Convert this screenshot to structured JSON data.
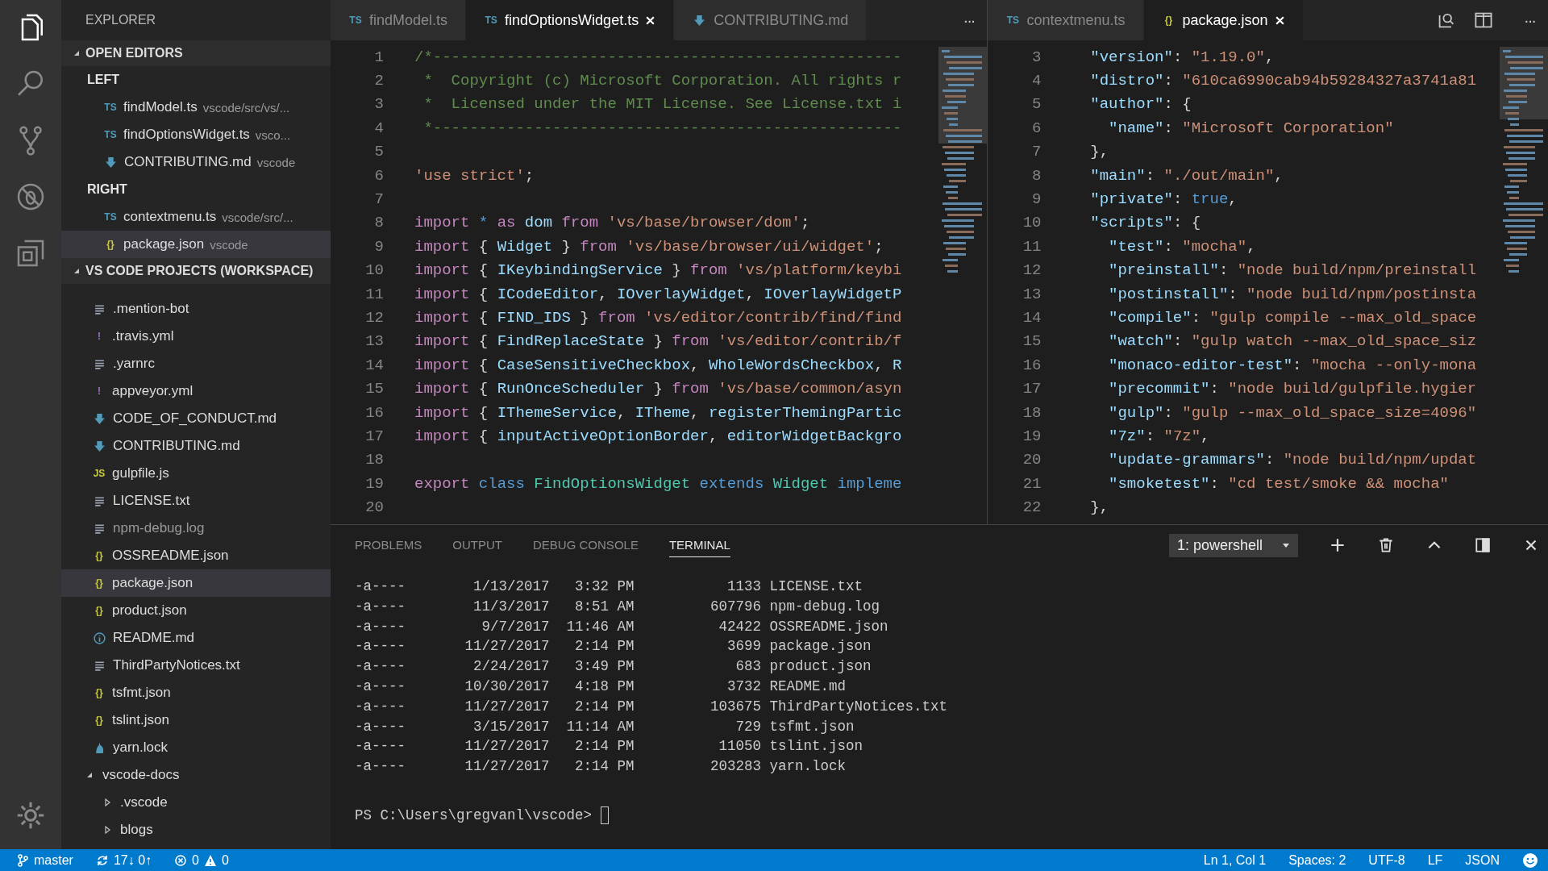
{
  "activity_bar": {
    "items": [
      {
        "kind": "files",
        "selected": true
      },
      {
        "kind": "search",
        "selected": false
      },
      {
        "kind": "scm",
        "selected": false
      },
      {
        "kind": "debug",
        "selected": false
      },
      {
        "kind": "extensions",
        "selected": false
      }
    ]
  },
  "sidebar": {
    "title": "EXPLORER",
    "open_editors": {
      "title": "OPEN EDITORS",
      "expanded": true,
      "groups": [
        {
          "label": "LEFT",
          "items": [
            {
              "icon_text": "TS",
              "kind": "ts",
              "name": "findModel.ts",
              "path": "vscode/src/vs/...",
              "selected": false
            },
            {
              "icon_text": "TS",
              "kind": "ts",
              "name": "findOptionsWidget.ts",
              "path": "vsco...",
              "selected": false
            },
            {
              "kind": "md",
              "name": "CONTRIBUTING.md",
              "path": "vscode",
              "selected": false
            }
          ]
        },
        {
          "label": "RIGHT",
          "items": [
            {
              "icon_text": "TS",
              "kind": "ts",
              "name": "contextmenu.ts",
              "path": "vscode/src/...",
              "selected": false
            },
            {
              "icon_text": "{}",
              "kind": "json",
              "name": "package.json",
              "path": "vscode",
              "selected": true
            }
          ]
        }
      ]
    },
    "workspace": {
      "title": "VS CODE PROJECTS (WORKSPACE)",
      "expanded": true,
      "items": [
        {
          "kind": "text",
          "name": ".mention-bot",
          "selected": false
        },
        {
          "icon_text": "!",
          "kind": "yaml",
          "name": ".travis.yml",
          "selected": false
        },
        {
          "kind": "text",
          "name": ".yarnrc",
          "selected": false
        },
        {
          "icon_text": "!",
          "kind": "yaml",
          "name": "appveyor.yml",
          "selected": false
        },
        {
          "kind": "md",
          "name": "CODE_OF_CONDUCT.md",
          "selected": false
        },
        {
          "kind": "md",
          "name": "CONTRIBUTING.md",
          "selected": false
        },
        {
          "icon_text": "JS",
          "kind": "js",
          "name": "gulpfile.js",
          "selected": false
        },
        {
          "kind": "text",
          "name": "LICENSE.txt",
          "selected": false
        },
        {
          "kind": "log",
          "name": "npm-debug.log",
          "selected": false
        },
        {
          "icon_text": "{}",
          "kind": "json",
          "name": "OSSREADME.json",
          "selected": false
        },
        {
          "icon_text": "{}",
          "kind": "json",
          "name": "package.json",
          "selected": true
        },
        {
          "icon_text": "{}",
          "kind": "json",
          "name": "product.json",
          "selected": false
        },
        {
          "kind": "info",
          "name": "README.md",
          "selected": false
        },
        {
          "kind": "text",
          "name": "ThirdPartyNotices.txt",
          "selected": false
        },
        {
          "icon_text": "{}",
          "kind": "json",
          "name": "tsfmt.json",
          "selected": false
        },
        {
          "icon_text": "{}",
          "kind": "json",
          "name": "tslint.json",
          "selected": false
        },
        {
          "kind": "yarn",
          "name": "yarn.lock",
          "selected": false
        },
        {
          "kind": "folder",
          "name": "vscode-docs",
          "selected": false,
          "expanded": true,
          "children": [
            {
              "kind": "folder",
              "name": ".vscode",
              "selected": false,
              "expanded": false
            },
            {
              "kind": "folder",
              "name": "blogs",
              "selected": false,
              "expanded": false
            }
          ]
        }
      ]
    }
  },
  "editor_groups": [
    {
      "tabs": [
        {
          "icon_text": "TS",
          "kind": "ts",
          "label": "findModel.ts",
          "selected": false
        },
        {
          "icon_text": "TS",
          "kind": "ts",
          "label": "findOptionsWidget.ts",
          "selected": true
        },
        {
          "kind": "md",
          "label": "CONTRIBUTING.md",
          "selected": false
        }
      ],
      "more_button": "···",
      "lines": [
        {
          "number": "1",
          "tokens": [
            {
              "kind": "comment",
              "text": "/*---------------------------------------------------"
            }
          ]
        },
        {
          "number": "2",
          "tokens": [
            {
              "kind": "comment",
              "text": " *  Copyright (c) Microsoft Corporation. All rights r"
            }
          ]
        },
        {
          "number": "3",
          "tokens": [
            {
              "kind": "comment",
              "text": " *  Licensed under the MIT License. See License.txt i"
            }
          ]
        },
        {
          "number": "4",
          "tokens": [
            {
              "kind": "comment",
              "text": " *---------------------------------------------------"
            }
          ]
        },
        {
          "number": "5"
        },
        {
          "number": "6",
          "tokens": [
            {
              "kind": "string",
              "text": "'use strict'"
            },
            {
              "kind": "plain",
              "text": ";"
            }
          ]
        },
        {
          "number": "7"
        },
        {
          "number": "8",
          "tokens": [
            {
              "kind": "keyword",
              "text": "import "
            },
            {
              "kind": "storage",
              "text": "* "
            },
            {
              "kind": "keyword",
              "text": "as "
            },
            {
              "kind": "identifier",
              "text": "dom "
            },
            {
              "kind": "keyword",
              "text": "from "
            },
            {
              "kind": "string",
              "text": "'vs/base/browser/dom'"
            },
            {
              "kind": "plain",
              "text": ";"
            }
          ]
        },
        {
          "number": "9",
          "tokens": [
            {
              "kind": "keyword",
              "text": "import "
            },
            {
              "kind": "plain",
              "text": "{ "
            },
            {
              "kind": "identifier",
              "text": "Widget "
            },
            {
              "kind": "plain",
              "text": "} "
            },
            {
              "kind": "keyword",
              "text": "from "
            },
            {
              "kind": "string",
              "text": "'vs/base/browser/ui/widget'"
            },
            {
              "kind": "plain",
              "text": ";"
            }
          ]
        },
        {
          "number": "10",
          "tokens": [
            {
              "kind": "keyword",
              "text": "import "
            },
            {
              "kind": "plain",
              "text": "{ "
            },
            {
              "kind": "identifier",
              "text": "IKeybindingService "
            },
            {
              "kind": "plain",
              "text": "} "
            },
            {
              "kind": "keyword",
              "text": "from "
            },
            {
              "kind": "string",
              "text": "'vs/platform/keybi"
            }
          ]
        },
        {
          "number": "11",
          "tokens": [
            {
              "kind": "keyword",
              "text": "import "
            },
            {
              "kind": "plain",
              "text": "{ "
            },
            {
              "kind": "identifier",
              "text": "ICodeEditor"
            },
            {
              "kind": "plain",
              "text": ", "
            },
            {
              "kind": "identifier",
              "text": "IOverlayWidget"
            },
            {
              "kind": "plain",
              "text": ", "
            },
            {
              "kind": "identifier",
              "text": "IOverlayWidgetP"
            }
          ]
        },
        {
          "number": "12",
          "tokens": [
            {
              "kind": "keyword",
              "text": "import "
            },
            {
              "kind": "plain",
              "text": "{ "
            },
            {
              "kind": "identifier",
              "text": "FIND_IDS "
            },
            {
              "kind": "plain",
              "text": "} "
            },
            {
              "kind": "keyword",
              "text": "from "
            },
            {
              "kind": "string",
              "text": "'vs/editor/contrib/find/find"
            }
          ]
        },
        {
          "number": "13",
          "tokens": [
            {
              "kind": "keyword",
              "text": "import "
            },
            {
              "kind": "plain",
              "text": "{ "
            },
            {
              "kind": "identifier",
              "text": "FindReplaceState "
            },
            {
              "kind": "plain",
              "text": "} "
            },
            {
              "kind": "keyword",
              "text": "from "
            },
            {
              "kind": "string",
              "text": "'vs/editor/contrib/f"
            }
          ]
        },
        {
          "number": "14",
          "tokens": [
            {
              "kind": "keyword",
              "text": "import "
            },
            {
              "kind": "plain",
              "text": "{ "
            },
            {
              "kind": "identifier",
              "text": "CaseSensitiveCheckbox"
            },
            {
              "kind": "plain",
              "text": ", "
            },
            {
              "kind": "identifier",
              "text": "WholeWordsCheckbox"
            },
            {
              "kind": "plain",
              "text": ", "
            },
            {
              "kind": "identifier",
              "text": "R"
            }
          ]
        },
        {
          "number": "15",
          "tokens": [
            {
              "kind": "keyword",
              "text": "import "
            },
            {
              "kind": "plain",
              "text": "{ "
            },
            {
              "kind": "identifier",
              "text": "RunOnceScheduler "
            },
            {
              "kind": "plain",
              "text": "} "
            },
            {
              "kind": "keyword",
              "text": "from "
            },
            {
              "kind": "string",
              "text": "'vs/base/common/asyn"
            }
          ]
        },
        {
          "number": "16",
          "tokens": [
            {
              "kind": "keyword",
              "text": "import "
            },
            {
              "kind": "plain",
              "text": "{ "
            },
            {
              "kind": "identifier",
              "text": "IThemeService"
            },
            {
              "kind": "plain",
              "text": ", "
            },
            {
              "kind": "identifier",
              "text": "ITheme"
            },
            {
              "kind": "plain",
              "text": ", "
            },
            {
              "kind": "identifier",
              "text": "registerThemingPartic"
            }
          ]
        },
        {
          "number": "17",
          "tokens": [
            {
              "kind": "keyword",
              "text": "import "
            },
            {
              "kind": "plain",
              "text": "{ "
            },
            {
              "kind": "identifier",
              "text": "inputActiveOptionBorder"
            },
            {
              "kind": "plain",
              "text": ", "
            },
            {
              "kind": "identifier",
              "text": "editorWidgetBackgro"
            }
          ]
        },
        {
          "number": "18"
        },
        {
          "number": "19",
          "tokens": [
            {
              "kind": "keyword",
              "text": "export "
            },
            {
              "kind": "storage",
              "text": "class "
            },
            {
              "kind": "type",
              "text": "FindOptionsWidget "
            },
            {
              "kind": "storage",
              "text": "extends "
            },
            {
              "kind": "type",
              "text": "Widget "
            },
            {
              "kind": "storage",
              "text": "impleme"
            }
          ]
        },
        {
          "number": "20"
        }
      ]
    },
    {
      "tabs": [
        {
          "icon_text": "TS",
          "kind": "ts",
          "label": "contextmenu.ts",
          "selected": false
        },
        {
          "icon_text": "{}",
          "kind": "json",
          "label": "package.json",
          "selected": true
        }
      ],
      "more_button": "···",
      "lines": [
        {
          "number": "3",
          "tokens": [
            {
              "kind": "identifier",
              "text": "  \"version\""
            },
            {
              "kind": "plain",
              "text": ": "
            },
            {
              "kind": "string",
              "text": "\"1.19.0\""
            },
            {
              "kind": "plain",
              "text": ","
            }
          ]
        },
        {
          "number": "4",
          "tokens": [
            {
              "kind": "identifier",
              "text": "  \"distro\""
            },
            {
              "kind": "plain",
              "text": ": "
            },
            {
              "kind": "string",
              "text": "\"610ca6990cab94b59284327a3741a81"
            }
          ]
        },
        {
          "number": "5",
          "tokens": [
            {
              "kind": "identifier",
              "text": "  \"author\""
            },
            {
              "kind": "plain",
              "text": ": {"
            }
          ]
        },
        {
          "number": "6",
          "tokens": [
            {
              "kind": "identifier",
              "text": "    \"name\""
            },
            {
              "kind": "plain",
              "text": ": "
            },
            {
              "kind": "string",
              "text": "\"Microsoft Corporation\""
            }
          ]
        },
        {
          "number": "7",
          "tokens": [
            {
              "kind": "plain",
              "text": "  },"
            }
          ]
        },
        {
          "number": "8",
          "tokens": [
            {
              "kind": "identifier",
              "text": "  \"main\""
            },
            {
              "kind": "plain",
              "text": ": "
            },
            {
              "kind": "string",
              "text": "\"./out/main\""
            },
            {
              "kind": "plain",
              "text": ","
            }
          ]
        },
        {
          "number": "9",
          "tokens": [
            {
              "kind": "identifier",
              "text": "  \"private\""
            },
            {
              "kind": "plain",
              "text": ": "
            },
            {
              "kind": "storage",
              "text": "true"
            },
            {
              "kind": "plain",
              "text": ","
            }
          ]
        },
        {
          "number": "10",
          "tokens": [
            {
              "kind": "identifier",
              "text": "  \"scripts\""
            },
            {
              "kind": "plain",
              "text": ": {"
            }
          ]
        },
        {
          "number": "11",
          "tokens": [
            {
              "kind": "identifier",
              "text": "    \"test\""
            },
            {
              "kind": "plain",
              "text": ": "
            },
            {
              "kind": "string",
              "text": "\"mocha\""
            },
            {
              "kind": "plain",
              "text": ","
            }
          ]
        },
        {
          "number": "12",
          "tokens": [
            {
              "kind": "identifier",
              "text": "    \"preinstall\""
            },
            {
              "kind": "plain",
              "text": ": "
            },
            {
              "kind": "string",
              "text": "\"node build/npm/preinstall"
            }
          ]
        },
        {
          "number": "13",
          "tokens": [
            {
              "kind": "identifier",
              "text": "    \"postinstall\""
            },
            {
              "kind": "plain",
              "text": ": "
            },
            {
              "kind": "string",
              "text": "\"node build/npm/postinsta"
            }
          ]
        },
        {
          "number": "14",
          "tokens": [
            {
              "kind": "identifier",
              "text": "    \"compile\""
            },
            {
              "kind": "plain",
              "text": ": "
            },
            {
              "kind": "string",
              "text": "\"gulp compile --max_old_space"
            }
          ]
        },
        {
          "number": "15",
          "tokens": [
            {
              "kind": "identifier",
              "text": "    \"watch\""
            },
            {
              "kind": "plain",
              "text": ": "
            },
            {
              "kind": "string",
              "text": "\"gulp watch --max_old_space_siz"
            }
          ]
        },
        {
          "number": "16",
          "tokens": [
            {
              "kind": "identifier",
              "text": "    \"monaco-editor-test\""
            },
            {
              "kind": "plain",
              "text": ": "
            },
            {
              "kind": "string",
              "text": "\"mocha --only-mona"
            }
          ]
        },
        {
          "number": "17",
          "tokens": [
            {
              "kind": "identifier",
              "text": "    \"precommit\""
            },
            {
              "kind": "plain",
              "text": ": "
            },
            {
              "kind": "string",
              "text": "\"node build/gulpfile.hygier"
            }
          ]
        },
        {
          "number": "18",
          "tokens": [
            {
              "kind": "identifier",
              "text": "    \"gulp\""
            },
            {
              "kind": "plain",
              "text": ": "
            },
            {
              "kind": "string",
              "text": "\"gulp --max_old_space_size=4096\""
            }
          ]
        },
        {
          "number": "19",
          "tokens": [
            {
              "kind": "identifier",
              "text": "    \"7z\""
            },
            {
              "kind": "plain",
              "text": ": "
            },
            {
              "kind": "string",
              "text": "\"7z\""
            },
            {
              "kind": "plain",
              "text": ","
            }
          ]
        },
        {
          "number": "20",
          "tokens": [
            {
              "kind": "identifier",
              "text": "    \"update-grammars\""
            },
            {
              "kind": "plain",
              "text": ": "
            },
            {
              "kind": "string",
              "text": "\"node build/npm/updat"
            }
          ]
        },
        {
          "number": "21",
          "tokens": [
            {
              "kind": "identifier",
              "text": "    \"smoketest\""
            },
            {
              "kind": "plain",
              "text": ": "
            },
            {
              "kind": "string",
              "text": "\"cd test/smoke && mocha\""
            }
          ]
        },
        {
          "number": "22",
          "tokens": [
            {
              "kind": "plain",
              "text": "  },"
            }
          ]
        }
      ]
    }
  ],
  "panel": {
    "tabs": [
      {
        "label": "PROBLEMS",
        "selected": false
      },
      {
        "label": "OUTPUT",
        "selected": false
      },
      {
        "label": "DEBUG CONSOLE",
        "selected": false
      },
      {
        "label": "TERMINAL",
        "selected": true
      }
    ],
    "terminal_select": "1: powershell",
    "terminal_lines": [
      "-a----        1/13/2017   3:32 PM           1133 LICENSE.txt",
      "-a----        11/3/2017   8:51 AM         607796 npm-debug.log",
      "-a----         9/7/2017  11:46 AM          42422 OSSREADME.json",
      "-a----       11/27/2017   2:14 PM           3699 package.json",
      "-a----        2/24/2017   3:49 PM            683 product.json",
      "-a----       10/30/2017   4:18 PM           3732 README.md",
      "-a----       11/27/2017   2:14 PM         103675 ThirdPartyNotices.txt",
      "-a----        3/15/2017  11:14 AM            729 tsfmt.json",
      "-a----       11/27/2017   2:14 PM          11050 tslint.json",
      "-a----       11/27/2017   2:14 PM         203283 yarn.lock"
    ],
    "prompt": "PS C:\\Users\\gregvanl\\vscode> "
  },
  "status_bar": {
    "branch": "master",
    "sync": "17↓ 0↑",
    "errors": "0",
    "warnings": "0",
    "right": [
      "Ln 1, Col 1",
      "Spaces: 2",
      "UTF-8",
      "LF",
      "JSON"
    ]
  }
}
